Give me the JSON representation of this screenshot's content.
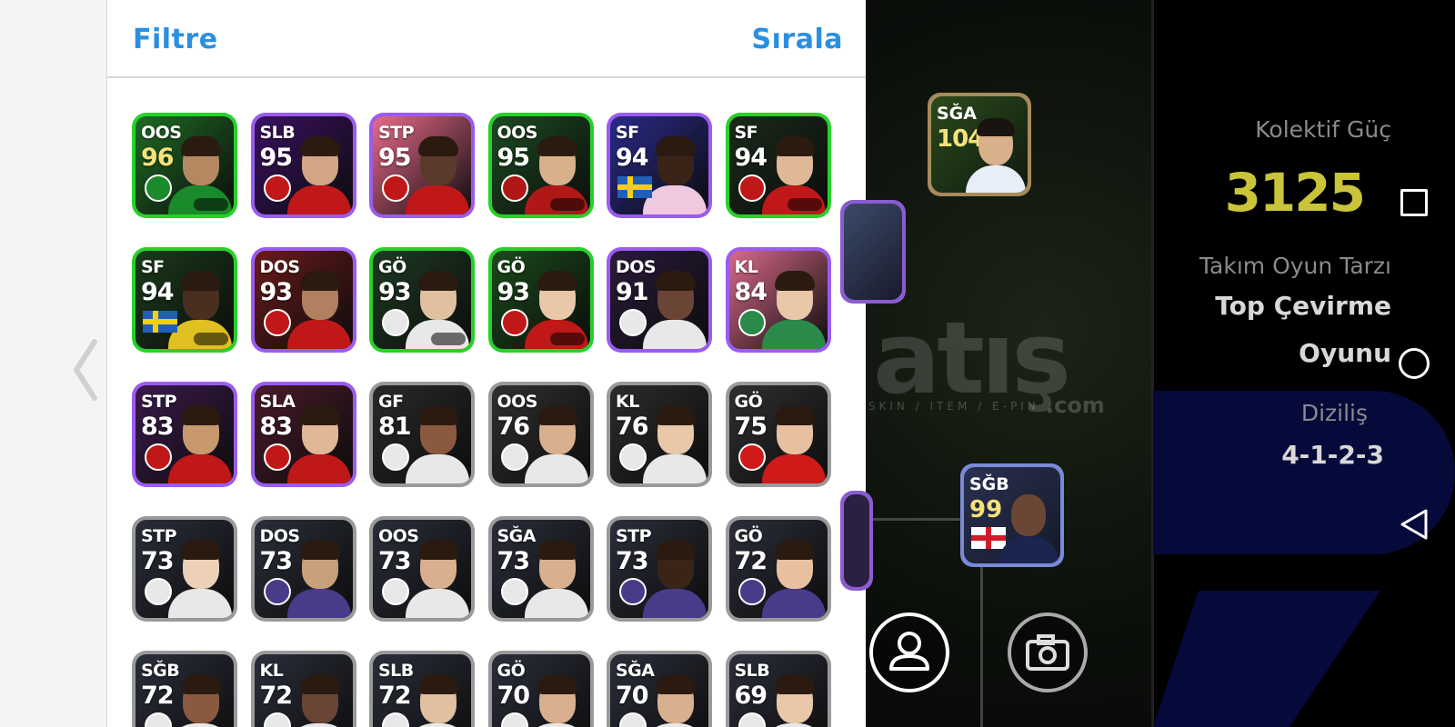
{
  "header": {
    "filter_label": "Filtre",
    "sort_label": "Sırala"
  },
  "colors": {
    "accent": "#2a8fe0",
    "green_frame": "#27d12a",
    "purple_frame": "#9a5cf0",
    "blue_frame": "#4f8ae8",
    "gray_frame": "#9a9a9a",
    "power": "#c9c43a"
  },
  "players": [
    {
      "pos": "OOS",
      "rating": "96",
      "frame": "green",
      "gold": true
    },
    {
      "pos": "SLB",
      "rating": "95",
      "frame": "purple"
    },
    {
      "pos": "STP",
      "rating": "95",
      "frame": "purple"
    },
    {
      "pos": "OOS",
      "rating": "95",
      "frame": "green"
    },
    {
      "pos": "SF",
      "rating": "94",
      "frame": "purple",
      "flag": "sweden"
    },
    {
      "pos": "SF",
      "rating": "94",
      "frame": "green"
    },
    {
      "pos": "SF",
      "rating": "94",
      "frame": "green",
      "flag": "sweden"
    },
    {
      "pos": "DOS",
      "rating": "93",
      "frame": "purple"
    },
    {
      "pos": "GÖ",
      "rating": "93",
      "frame": "green"
    },
    {
      "pos": "GÖ",
      "rating": "93",
      "frame": "green"
    },
    {
      "pos": "DOS",
      "rating": "91",
      "frame": "purple"
    },
    {
      "pos": "KL",
      "rating": "84",
      "frame": "purple"
    },
    {
      "pos": "STP",
      "rating": "83",
      "frame": "purple"
    },
    {
      "pos": "SLA",
      "rating": "83",
      "frame": "purple"
    },
    {
      "pos": "GF",
      "rating": "81",
      "frame": "gray"
    },
    {
      "pos": "OOS",
      "rating": "76",
      "frame": "gray"
    },
    {
      "pos": "KL",
      "rating": "76",
      "frame": "gray"
    },
    {
      "pos": "GÖ",
      "rating": "75",
      "frame": "gray"
    },
    {
      "pos": "STP",
      "rating": "73",
      "frame": "gray"
    },
    {
      "pos": "DOS",
      "rating": "73",
      "frame": "gray"
    },
    {
      "pos": "OOS",
      "rating": "73",
      "frame": "gray"
    },
    {
      "pos": "SĞA",
      "rating": "73",
      "frame": "gray"
    },
    {
      "pos": "STP",
      "rating": "73",
      "frame": "gray"
    },
    {
      "pos": "GÖ",
      "rating": "72",
      "frame": "gray"
    },
    {
      "pos": "SĞB",
      "rating": "72",
      "frame": "gray"
    },
    {
      "pos": "KL",
      "rating": "72",
      "frame": "gray"
    },
    {
      "pos": "SLB",
      "rating": "72",
      "frame": "gray"
    },
    {
      "pos": "GÖ",
      "rating": "70",
      "frame": "gray"
    },
    {
      "pos": "SĞA",
      "rating": "70",
      "frame": "gray"
    },
    {
      "pos": "SLB",
      "rating": "69",
      "frame": "gray"
    }
  ],
  "field_players": [
    {
      "pos": "SĞA",
      "rating": "104"
    },
    {
      "pos": "SĞB",
      "rating": "99"
    }
  ],
  "watermark": {
    "main": "atış",
    "sub": "P / SKIN / ITEM / E-PIN",
    "com": ".com"
  },
  "info": {
    "power_label": "Kolektif Güç",
    "power_value": "3125",
    "style_label": "Takım Oyun Tarzı",
    "style_value_1": "Top Çevirme",
    "style_value_2": "Oyunu",
    "formation_label": "Diziliş",
    "formation_value": "4-1-2-3"
  },
  "icons": [
    "back-chevron-icon",
    "profile-icon",
    "camera-icon",
    "nav-recent-icon",
    "nav-home-icon",
    "nav-back-icon"
  ]
}
